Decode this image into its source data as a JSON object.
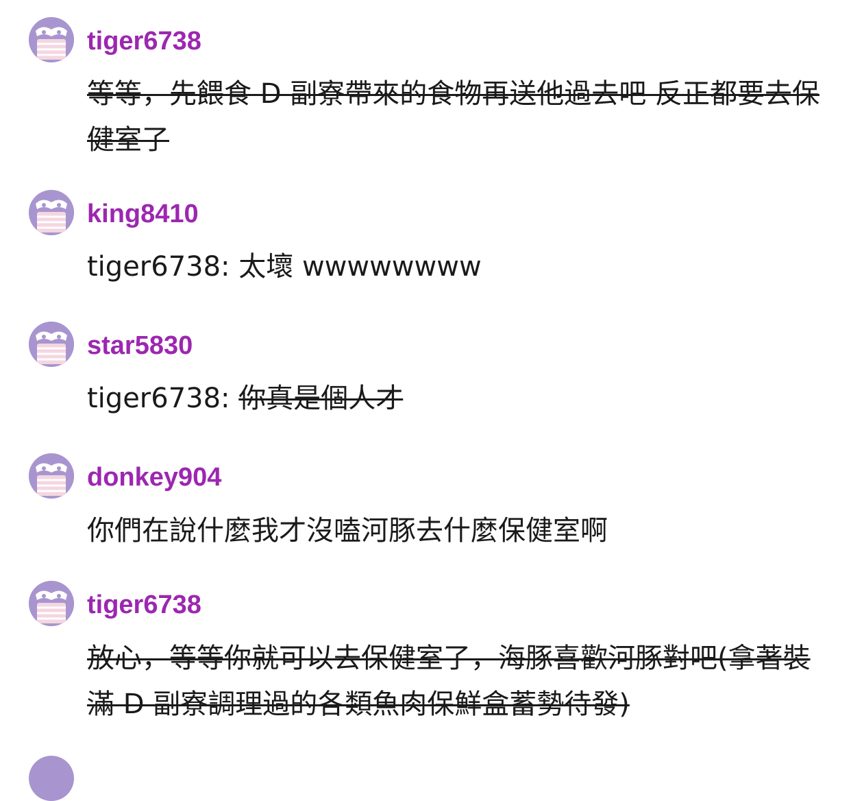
{
  "comments": [
    {
      "username": "tiger6738",
      "text": "等等，先餵食 D 副寮帶來的食物再送他過去吧 反正都要去保健室了",
      "strikethrough": true
    },
    {
      "username": "king8410",
      "prefix": "tiger6738: ",
      "text": "太壞 wwwwwwww",
      "strikethrough": false
    },
    {
      "username": "star5830",
      "prefix": "tiger6738: ",
      "text": "你真是個人才",
      "strikethrough": true
    },
    {
      "username": "donkey904",
      "text": "你們在說什麼我才沒嗑河豚去什麼保健室啊",
      "strikethrough": false
    },
    {
      "username": "tiger6738",
      "text": "放心，等等你就可以去保健室了，海豚喜歡河豚對吧(拿著裝滿 D 副寮調理過的各類魚肉保鮮盒蓄勢待發)",
      "strikethrough": true
    }
  ],
  "colors": {
    "username": "#9c27b0",
    "avatar_bg": "#a895cf",
    "text": "#1a1a1a"
  },
  "icons": {
    "avatar": "masked-face-avatar-icon"
  }
}
